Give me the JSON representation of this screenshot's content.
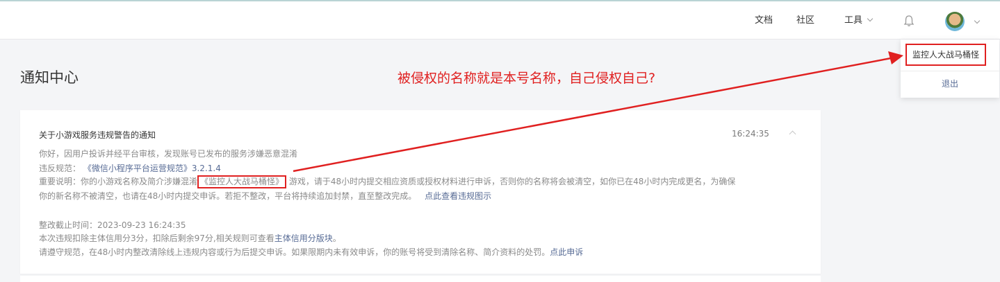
{
  "header": {
    "nav": {
      "docs": "文档",
      "community": "社区",
      "tools": "工具"
    },
    "menu": {
      "account_name": "监控人大战马桶怪",
      "logout": "退出"
    }
  },
  "page": {
    "title": "通知中心"
  },
  "annotation": {
    "text": "被侵权的名称就是本号名称，自己侵权自己?"
  },
  "notice": {
    "title": "关于小游戏服务违规警告的通知",
    "time": "16:24:35",
    "greeting": "你好，因用户投诉并经平台审核，发现账号已发布的服务涉嫌恶意混淆",
    "rule_label": "违反规范：",
    "rule_link": "《微信小程序平台运营规范》3.2.1.4",
    "important_prefix": "重要说明：你的小游戏名称及简介涉嫌混淆",
    "important_name": "《监控人大战马桶怪》",
    "important_suffix": "游戏，请于48小时内提交相应资质或授权材料进行申诉，否则你的名称将会被清空，如你已在48小时内完成更名，为确保",
    "important_line2": "你的新名称不被清空，也请在48小时内提交申诉。若拒不整改，平台将持续追加封禁，直至整改完成。",
    "view_link": "点此查看违规图示",
    "deadline": "整改截止时间：2023-09-23 16:24:35",
    "deduct_text": "本次违规扣除主体信用分3分，扣除后剩余97分,相关规则可查看",
    "credit_link": "主体信用分版块",
    "deduct_end": "。",
    "comply_text": "请遵守规范，在48小时内整改清除线上违规内容或行为后提交申诉。如果限期内未有效申诉，你的账号将受到清除名称、简介资料的处罚。",
    "appeal_link": "点此申诉"
  },
  "colors": {
    "accent_link": "#576b95",
    "annotation_red": "#e02020"
  }
}
